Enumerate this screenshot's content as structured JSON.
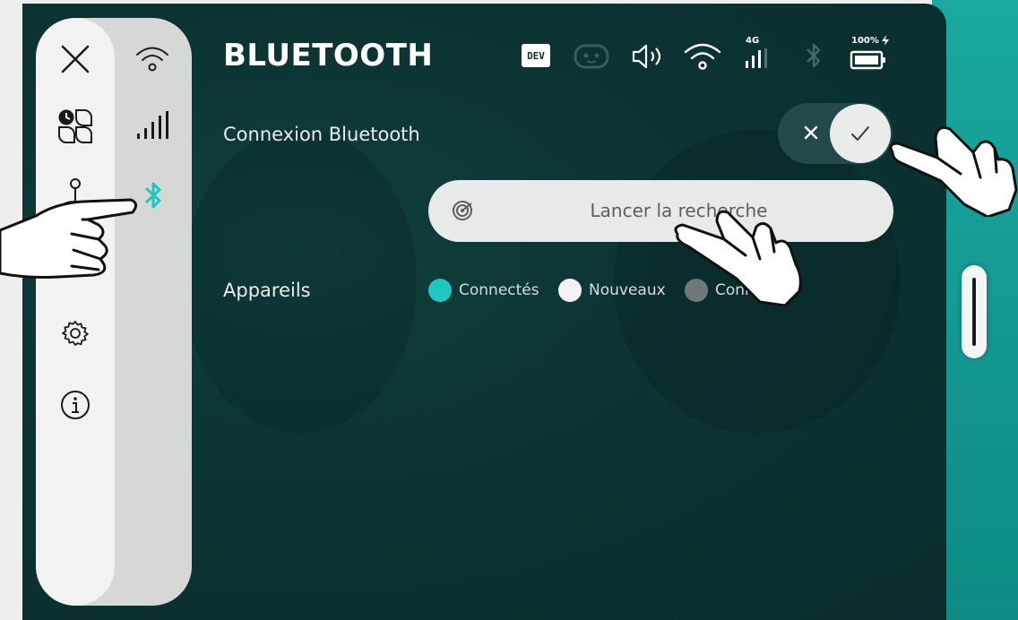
{
  "header": {
    "title": "BLUETOOTH",
    "dev_badge": "DEV",
    "network_type": "4G",
    "battery_level": "100%",
    "icons": [
      "dev-badge",
      "robot-face-icon",
      "volume-icon",
      "wifi-icon",
      "cellular-signal-icon",
      "bluetooth-icon",
      "battery-icon"
    ]
  },
  "sidebar": {
    "left_column": [
      "close-icon",
      "apps-clock-icon",
      "user-joystick-icon",
      "settings-icon",
      "info-icon"
    ],
    "right_column": [
      "wifi-icon",
      "signal-bars-icon",
      "bluetooth-icon"
    ],
    "active_item": "bluetooth"
  },
  "bluetooth": {
    "connection_label": "Connexion Bluetooth",
    "connection_enabled": true,
    "search_button_label": "Lancer la recherche",
    "devices_label": "Appareils"
  },
  "legend": [
    {
      "label": "Connectés",
      "color": "#1ec8c0"
    },
    {
      "label": "Nouveaux",
      "color": "#f2f2f2"
    },
    {
      "label": "Connus",
      "color": "#6f7878"
    }
  ],
  "colors": {
    "accent": "#1ec8c0",
    "background": "#0c3433",
    "sidebar": "#d6d8d6"
  }
}
